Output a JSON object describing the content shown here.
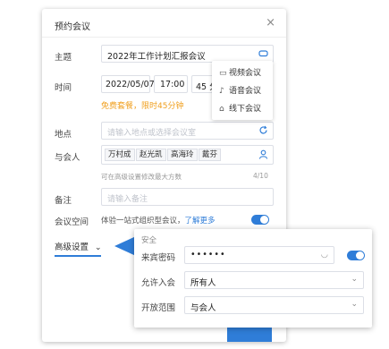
{
  "dialog": {
    "title": "预约会议",
    "close": "×"
  },
  "form": {
    "subject_label": "主题",
    "subject_value": "2022年工作计划汇报会议",
    "time_label": "时间",
    "date_value": "2022/05/07",
    "hour_value": "17:00",
    "duration_value": "45 分",
    "free_notice": "免费套餐，限时45分钟",
    "location_label": "地点",
    "location_placeholder": "请输入地点或选择会议室",
    "attendees_label": "与会人",
    "attendees": [
      "万村成",
      "赵光凯",
      "高海玲",
      "戴芬"
    ],
    "attendees_hint": "可在高级设置修改最大方数",
    "attendees_count": "4/10",
    "notes_label": "备注",
    "notes_placeholder": "请输入备注",
    "space_label": "会议空间",
    "space_desc": "体验一站式组织型会议，",
    "space_link": "了解更多",
    "advanced_label": "高级设置"
  },
  "meeting_type_menu": {
    "items": [
      "视频会议",
      "语音会议",
      "线下会议"
    ]
  },
  "advanced_panel": {
    "section_title": "安全",
    "password_label": "来宾密码",
    "password_value": "••••••",
    "allow_label": "允许入会",
    "allow_value": "所有人",
    "scope_label": "开放范围",
    "scope_value": "与会人"
  },
  "colors": {
    "accent": "#2f7dd8",
    "notice": "#f0a020",
    "advanced_underline": "#2f7dd8"
  }
}
